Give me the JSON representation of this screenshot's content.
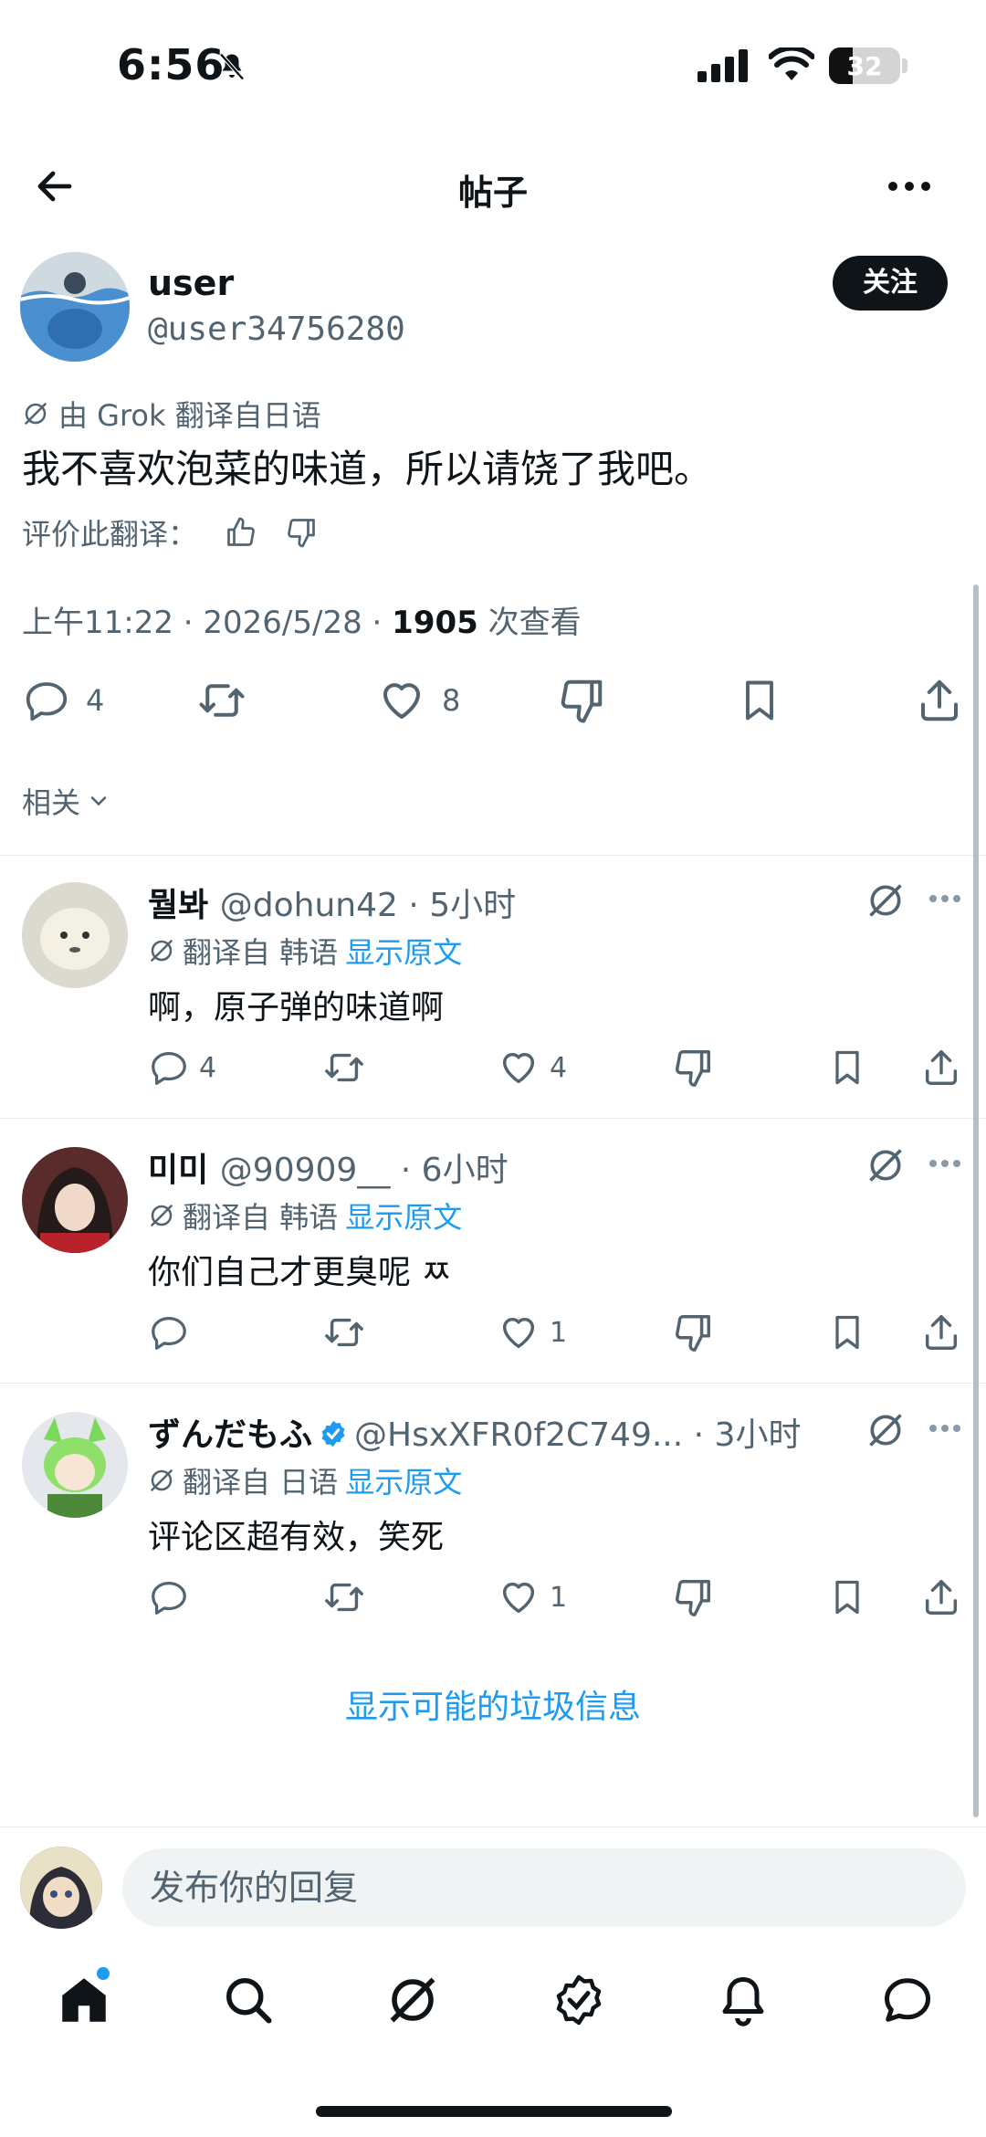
{
  "status": {
    "time": "6:56",
    "battery": "32"
  },
  "nav": {
    "title": "帖子"
  },
  "post": {
    "display_name": "user",
    "handle": "@user34756280",
    "follow_label": "关注",
    "translation_note": "由 Grok 翻译自日语",
    "text": "我不喜欢泡菜的味道，所以请饶了我吧。",
    "rate_label": "评价此翻译：",
    "meta_time": "上午11:22 · 2026/5/28 · ",
    "views": "1905",
    "views_label": " 次查看",
    "replies": "4",
    "likes": "8",
    "related_label": "相关"
  },
  "replies": [
    {
      "name": "뭘봐",
      "handle": "@dohun42",
      "time": " · 5小时",
      "verified": false,
      "trans": "翻译自 韩语",
      "show": "显示原文",
      "text": "啊，原子弹的味道啊",
      "replies": "4",
      "likes": "4"
    },
    {
      "name": "미미",
      "handle": "@90909__",
      "time": " · 6小时",
      "verified": false,
      "trans": "翻译自 韩语",
      "show": "显示原文",
      "text": "你们自己才更臭呢 ㅉ",
      "replies": "",
      "likes": "1"
    },
    {
      "name": "ずんだもふ",
      "handle": "@HsxXFR0f2C749...",
      "time": " · 3小时",
      "verified": true,
      "trans": "翻译自 日语",
      "show": "显示原文",
      "text": "评论区超有效，笑死",
      "replies": "",
      "likes": "1"
    }
  ],
  "spam_label": "显示可能的垃圾信息",
  "composer": {
    "placeholder": "发布你的回复"
  },
  "colors": {
    "accent": "#1d9bf0",
    "text": "#0f1419",
    "muted": "#536471"
  }
}
